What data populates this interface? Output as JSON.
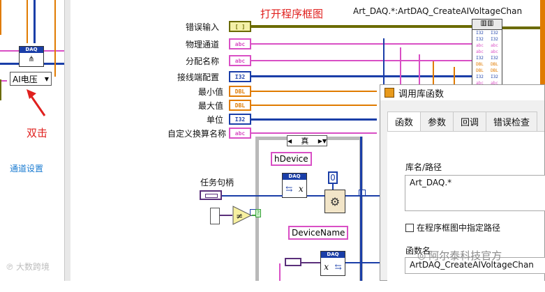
{
  "left": {
    "ai_select_value": "AI电压",
    "double_click_text": "双击",
    "channel_settings_text": "通道设置",
    "daq_tag": "DAQ"
  },
  "diagram": {
    "open_label": "打开程序框图",
    "header_path": "Art_DAQ.*:ArtDAQ_CreateAIVoltageChan",
    "inputs": [
      {
        "label": "错误输入",
        "type": "[ ]",
        "color": "#6b6b00"
      },
      {
        "label": "物理通道",
        "type": "abc",
        "color": "#d94fc5"
      },
      {
        "label": "分配名称",
        "type": "abc",
        "color": "#d94fc5"
      },
      {
        "label": "接线端配置",
        "type": "I32",
        "color": "#1a3ea8"
      },
      {
        "label": "最小值",
        "type": "DBL",
        "color": "#e07b00"
      },
      {
        "label": "最大值",
        "type": "DBL",
        "color": "#e07b00"
      },
      {
        "label": "单位",
        "type": "I32",
        "color": "#1a3ea8"
      },
      {
        "label": "自定义换算名称",
        "type": "abc",
        "color": "#d94fc5"
      }
    ],
    "case_selector": "真",
    "hdevice": "hDevice",
    "device_name": "DeviceName",
    "task_handle": "任务句柄",
    "zero_const": "0",
    "daq_tag": "DAQ",
    "x_glyph": "x"
  },
  "dialog": {
    "title": "调用库函数",
    "tabs": [
      "函数",
      "参数",
      "回调",
      "错误检查"
    ],
    "lib_path_label": "库名/路径",
    "lib_path_value": "Art_DAQ.*",
    "specify_path_label": "在程序框图中指定路径",
    "function_name_label": "函数名",
    "function_name_value": "ArtDAQ_CreateAIVoltageChan"
  },
  "watermarks": {
    "left": "大数跨境",
    "right": "阿尔泰科技官方"
  }
}
